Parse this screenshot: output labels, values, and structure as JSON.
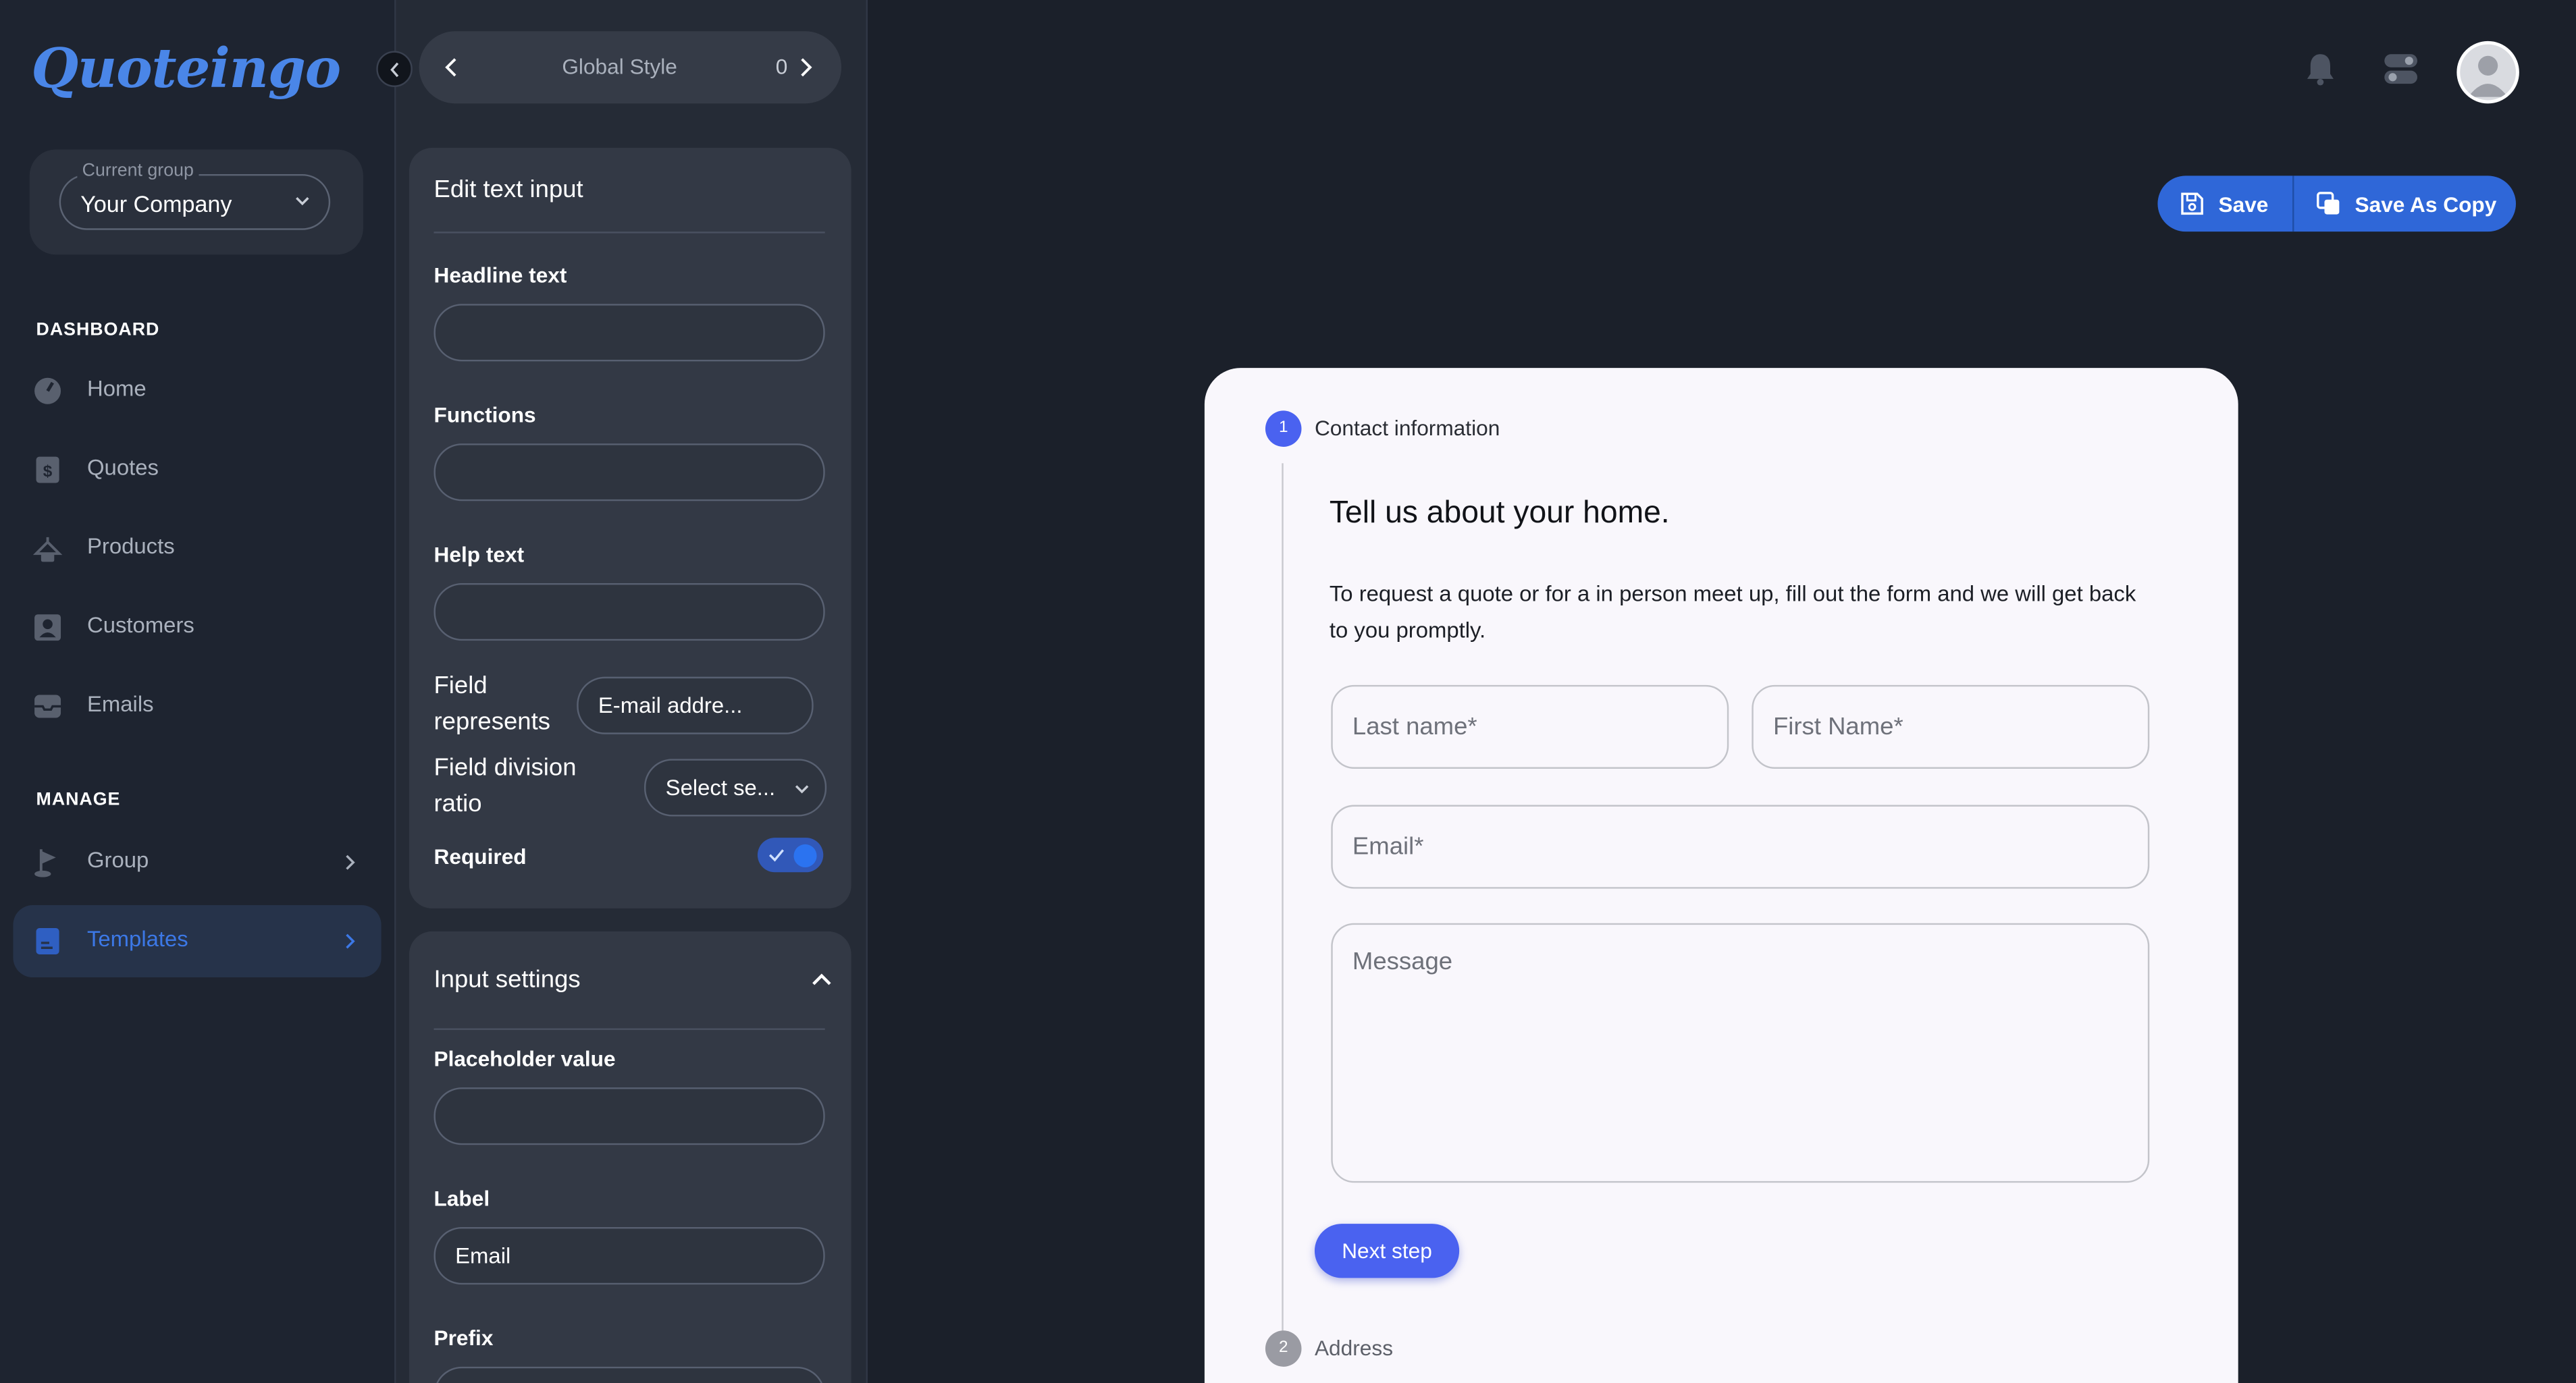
{
  "brand": {
    "logo_text": "Quoteingo",
    "accent": "#4a86e8"
  },
  "sidebar": {
    "group_legend": "Current group",
    "group_value": "Your Company",
    "sections": {
      "dashboard": "DASHBOARD",
      "manage": "MANAGE"
    },
    "items": [
      {
        "label": "Home",
        "icon": "gauge-icon"
      },
      {
        "label": "Quotes",
        "icon": "dollar-document-icon"
      },
      {
        "label": "Products",
        "icon": "hanger-icon"
      },
      {
        "label": "Customers",
        "icon": "person-card-icon"
      },
      {
        "label": "Emails",
        "icon": "inbox-icon"
      },
      {
        "label": "Group",
        "icon": "flag-icon"
      },
      {
        "label": "Templates",
        "icon": "template-document-icon",
        "active": true
      }
    ]
  },
  "style_nav": {
    "title": "Global Style",
    "count": "0"
  },
  "edit_panel": {
    "title": "Edit text input",
    "headline_label": "Headline text",
    "headline_value": "",
    "functions_label": "Functions",
    "functions_value": "",
    "help_label": "Help text",
    "help_value": "",
    "field_represents_label": "Field represents",
    "field_represents_value": "E-mail addre...",
    "division_label": "Field division ratio",
    "division_value": "Select se...",
    "required_label": "Required",
    "required_on": true
  },
  "input_settings": {
    "title": "Input settings",
    "placeholder_label": "Placeholder value",
    "placeholder_value": "",
    "label_label": "Label",
    "label_value": "Email",
    "prefix_label": "Prefix"
  },
  "actions": {
    "save_label": "Save",
    "save_copy_label": "Save As Copy"
  },
  "form": {
    "step1_number": "1",
    "step1_label": "Contact information",
    "title": "Tell us about your home.",
    "description": "To request a quote or for a in person meet up, fill out the form and we will get back to you promptly.",
    "last_name_placeholder": "Last name*",
    "first_name_placeholder": "First Name*",
    "email_placeholder": "Email*",
    "message_placeholder": "Message",
    "next_label": "Next step",
    "step2_number": "2",
    "step2_label": "Address",
    "step_active_color": "#4a62f0",
    "step_inactive_color": "#9a9ba3"
  }
}
